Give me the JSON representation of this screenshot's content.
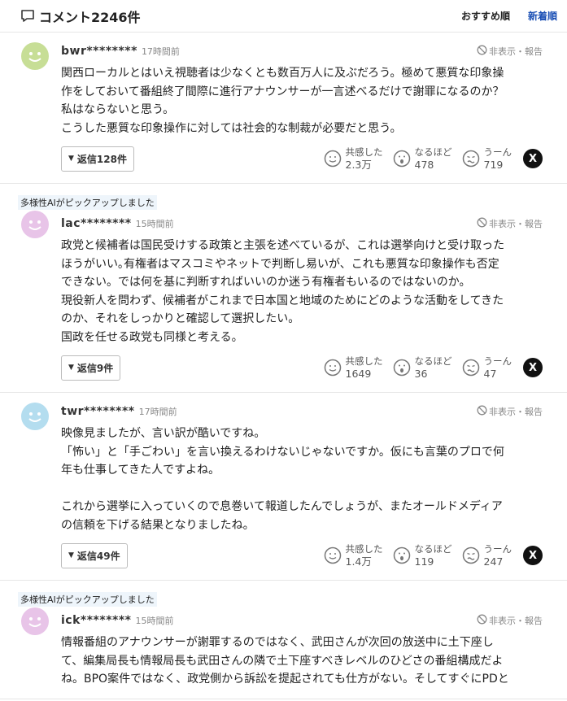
{
  "header": {
    "title": "コメント2246件",
    "sort_recommended": "おすすめ順",
    "sort_newest": "新着順"
  },
  "report_label": "非表示・報告",
  "reply_prefix": "返信",
  "reaction_labels": {
    "like": "共感した",
    "insight": "なるほど",
    "hmm": "うーん"
  },
  "x_label": "X",
  "comments": [
    {
      "pick": "",
      "user": "bwr********",
      "time": "17時間前",
      "avatar_color": "#c7de96",
      "body": "関西ローカルとはいえ視聴者は少なくとも数百万人に及ぶだろう。極めて悪質な印象操\n作をしておいて番組終了間際に進行アナウンサーが一言述べるだけで謝罪になるのか？\n私はならないと思う。\nこうした悪質な印象操作に対しては社会的な制裁が必要だと思う。",
      "reply": "返信128件",
      "likes": "2.3万",
      "insight": "478",
      "hmm": "719"
    },
    {
      "pick": "多様性AIがピックアップしました",
      "user": "lac********",
      "time": "15時間前",
      "avatar_color": "#e8c4e8",
      "body": "政党と候補者は国民受けする政策と主張を述べているが、これは選挙向けと受け取った\nほうがいい｡有権者はマスコミやネットで判断し易いが、これも悪質な印象操作も否定\nできない。では何を基に判断すればいいのか迷う有権者もいるのではないのか。\n現役新人を問わず、候補者がこれまで日本国と地域のためにどのような活動をしてきた\nのか、それをしっかりと確認して選択したい。\n国政を任せる政党も同様と考える。",
      "reply": "返信9件",
      "likes": "1649",
      "insight": "36",
      "hmm": "47"
    },
    {
      "pick": "",
      "user": "twr********",
      "time": "17時間前",
      "avatar_color": "#b4ddef",
      "body": "映像見ましたが、言い訳が酷いですね。\n「怖い」と「手ごわい」を言い換えるわけないじゃないですか。仮にも言葉のプロで何\n年も仕事してきた人ですよね。\n\nこれから選挙に入っていくので息巻いて報道したんでしょうが、またオールドメディア\nの信頼を下げる結果となりましたね。",
      "reply": "返信49件",
      "likes": "1.4万",
      "insight": "119",
      "hmm": "247"
    },
    {
      "pick": "多様性AIがピックアップしました",
      "user": "ick********",
      "time": "15時間前",
      "avatar_color": "#e8c4e8",
      "body": "情報番組のアナウンサーが謝罪するのではなく、武田さんが次回の放送中に土下座し\nて、編集局長も情報局長も武田さんの隣で土下座すべきレベルのひどさの番組構成だよ\nね。BPO案件ではなく、政党側から訴訟を提起されても仕方がない。そしてすぐにPDと",
      "reply": "",
      "likes": "",
      "insight": "",
      "hmm": ""
    }
  ]
}
